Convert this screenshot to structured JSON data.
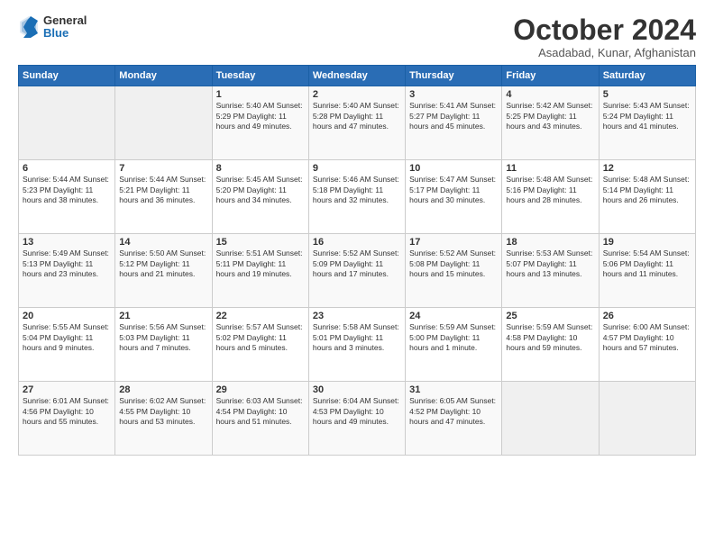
{
  "logo": {
    "general": "General",
    "blue": "Blue"
  },
  "title": "October 2024",
  "location": "Asadabad, Kunar, Afghanistan",
  "headers": [
    "Sunday",
    "Monday",
    "Tuesday",
    "Wednesday",
    "Thursday",
    "Friday",
    "Saturday"
  ],
  "weeks": [
    [
      {
        "day": "",
        "info": ""
      },
      {
        "day": "",
        "info": ""
      },
      {
        "day": "1",
        "info": "Sunrise: 5:40 AM\nSunset: 5:29 PM\nDaylight: 11 hours and 49 minutes."
      },
      {
        "day": "2",
        "info": "Sunrise: 5:40 AM\nSunset: 5:28 PM\nDaylight: 11 hours and 47 minutes."
      },
      {
        "day": "3",
        "info": "Sunrise: 5:41 AM\nSunset: 5:27 PM\nDaylight: 11 hours and 45 minutes."
      },
      {
        "day": "4",
        "info": "Sunrise: 5:42 AM\nSunset: 5:25 PM\nDaylight: 11 hours and 43 minutes."
      },
      {
        "day": "5",
        "info": "Sunrise: 5:43 AM\nSunset: 5:24 PM\nDaylight: 11 hours and 41 minutes."
      }
    ],
    [
      {
        "day": "6",
        "info": "Sunrise: 5:44 AM\nSunset: 5:23 PM\nDaylight: 11 hours and 38 minutes."
      },
      {
        "day": "7",
        "info": "Sunrise: 5:44 AM\nSunset: 5:21 PM\nDaylight: 11 hours and 36 minutes."
      },
      {
        "day": "8",
        "info": "Sunrise: 5:45 AM\nSunset: 5:20 PM\nDaylight: 11 hours and 34 minutes."
      },
      {
        "day": "9",
        "info": "Sunrise: 5:46 AM\nSunset: 5:18 PM\nDaylight: 11 hours and 32 minutes."
      },
      {
        "day": "10",
        "info": "Sunrise: 5:47 AM\nSunset: 5:17 PM\nDaylight: 11 hours and 30 minutes."
      },
      {
        "day": "11",
        "info": "Sunrise: 5:48 AM\nSunset: 5:16 PM\nDaylight: 11 hours and 28 minutes."
      },
      {
        "day": "12",
        "info": "Sunrise: 5:48 AM\nSunset: 5:14 PM\nDaylight: 11 hours and 26 minutes."
      }
    ],
    [
      {
        "day": "13",
        "info": "Sunrise: 5:49 AM\nSunset: 5:13 PM\nDaylight: 11 hours and 23 minutes."
      },
      {
        "day": "14",
        "info": "Sunrise: 5:50 AM\nSunset: 5:12 PM\nDaylight: 11 hours and 21 minutes."
      },
      {
        "day": "15",
        "info": "Sunrise: 5:51 AM\nSunset: 5:11 PM\nDaylight: 11 hours and 19 minutes."
      },
      {
        "day": "16",
        "info": "Sunrise: 5:52 AM\nSunset: 5:09 PM\nDaylight: 11 hours and 17 minutes."
      },
      {
        "day": "17",
        "info": "Sunrise: 5:52 AM\nSunset: 5:08 PM\nDaylight: 11 hours and 15 minutes."
      },
      {
        "day": "18",
        "info": "Sunrise: 5:53 AM\nSunset: 5:07 PM\nDaylight: 11 hours and 13 minutes."
      },
      {
        "day": "19",
        "info": "Sunrise: 5:54 AM\nSunset: 5:06 PM\nDaylight: 11 hours and 11 minutes."
      }
    ],
    [
      {
        "day": "20",
        "info": "Sunrise: 5:55 AM\nSunset: 5:04 PM\nDaylight: 11 hours and 9 minutes."
      },
      {
        "day": "21",
        "info": "Sunrise: 5:56 AM\nSunset: 5:03 PM\nDaylight: 11 hours and 7 minutes."
      },
      {
        "day": "22",
        "info": "Sunrise: 5:57 AM\nSunset: 5:02 PM\nDaylight: 11 hours and 5 minutes."
      },
      {
        "day": "23",
        "info": "Sunrise: 5:58 AM\nSunset: 5:01 PM\nDaylight: 11 hours and 3 minutes."
      },
      {
        "day": "24",
        "info": "Sunrise: 5:59 AM\nSunset: 5:00 PM\nDaylight: 11 hours and 1 minute."
      },
      {
        "day": "25",
        "info": "Sunrise: 5:59 AM\nSunset: 4:58 PM\nDaylight: 10 hours and 59 minutes."
      },
      {
        "day": "26",
        "info": "Sunrise: 6:00 AM\nSunset: 4:57 PM\nDaylight: 10 hours and 57 minutes."
      }
    ],
    [
      {
        "day": "27",
        "info": "Sunrise: 6:01 AM\nSunset: 4:56 PM\nDaylight: 10 hours and 55 minutes."
      },
      {
        "day": "28",
        "info": "Sunrise: 6:02 AM\nSunset: 4:55 PM\nDaylight: 10 hours and 53 minutes."
      },
      {
        "day": "29",
        "info": "Sunrise: 6:03 AM\nSunset: 4:54 PM\nDaylight: 10 hours and 51 minutes."
      },
      {
        "day": "30",
        "info": "Sunrise: 6:04 AM\nSunset: 4:53 PM\nDaylight: 10 hours and 49 minutes."
      },
      {
        "day": "31",
        "info": "Sunrise: 6:05 AM\nSunset: 4:52 PM\nDaylight: 10 hours and 47 minutes."
      },
      {
        "day": "",
        "info": ""
      },
      {
        "day": "",
        "info": ""
      }
    ]
  ]
}
